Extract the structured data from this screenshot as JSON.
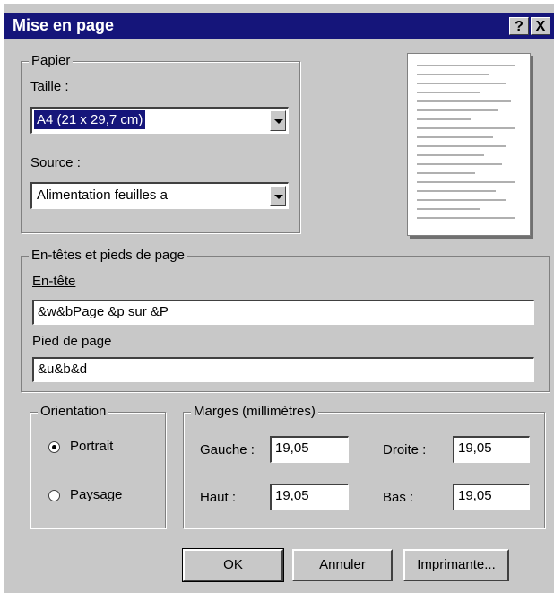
{
  "titlebar": {
    "title": "Mise en page",
    "help_glyph": "?",
    "close_glyph": "X"
  },
  "papier": {
    "legend": "Papier",
    "taille_label": "Taille :",
    "taille_value": "A4 (21 x 29,7 cm)",
    "source_label": "Source :",
    "source_value": "Alimentation feuilles a"
  },
  "headers": {
    "legend": "En-têtes et pieds de page",
    "entete_label": "En-tête",
    "entete_value": "&w&bPage &p sur &P",
    "pied_label": "Pied de page",
    "pied_value": "&u&b&d"
  },
  "orientation": {
    "legend": "Orientation",
    "portrait_label": "Portrait",
    "paysage_label": "Paysage",
    "selected": "Portrait"
  },
  "marges": {
    "legend": "Marges (millimètres)",
    "gauche_label": "Gauche :",
    "gauche_value": "19,05",
    "droite_label": "Droite :",
    "droite_value": "19,05",
    "haut_label": "Haut :",
    "haut_value": "19,05",
    "bas_label": "Bas :",
    "bas_value": "19,05"
  },
  "buttons": {
    "ok": "OK",
    "annuler": "Annuler",
    "imprimante": "Imprimante..."
  },
  "colors": {
    "titlebar": "#15157a",
    "face": "#c8c8c8",
    "selection": "#15157a"
  }
}
